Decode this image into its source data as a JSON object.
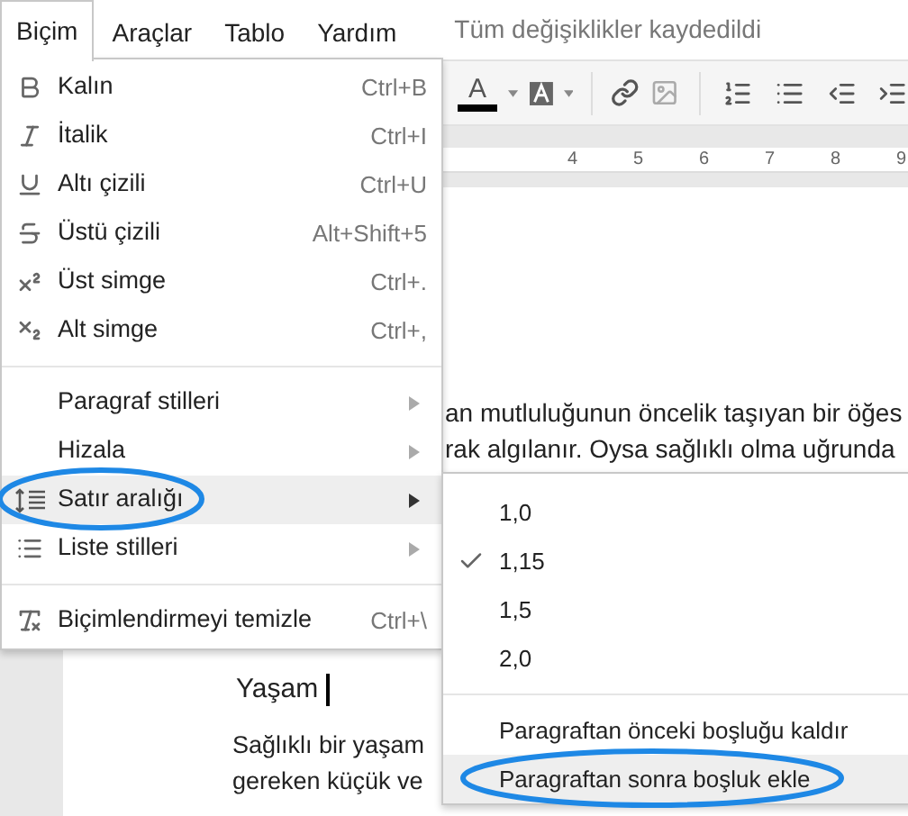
{
  "menubar": [
    {
      "label": "Biçim",
      "selected": true
    },
    {
      "label": "Araçlar",
      "selected": false
    },
    {
      "label": "Tablo",
      "selected": false
    },
    {
      "label": "Yardım",
      "selected": false
    }
  ],
  "save_status": "Tüm değişiklikler kaydedildi",
  "toolbar": {
    "text_color_label": "A"
  },
  "ruler": {
    "labels": [
      "4",
      "5",
      "6",
      "7",
      "8",
      "9"
    ]
  },
  "document": {
    "lines_top": [
      "an mutluluğunun öncelik taşıyan bir öğes",
      "rak algılanır. Oysa sağlıklı olma uğrunda"
    ],
    "heading": "Yaşam",
    "lines_bottom": [
      "Sağlıklı bir yaşam",
      "gereken küçük ve"
    ]
  },
  "format_menu": {
    "groups": [
      [
        {
          "label": "Kalın",
          "shortcut": "Ctrl+B",
          "submenu": false,
          "selected": false
        },
        {
          "label": "İtalik",
          "shortcut": "Ctrl+I",
          "submenu": false,
          "selected": false
        },
        {
          "label": "Altı çizili",
          "shortcut": "Ctrl+U",
          "submenu": false,
          "selected": false
        },
        {
          "label": "Üstü çizili",
          "shortcut": "Alt+Shift+5",
          "submenu": false,
          "selected": false
        },
        {
          "label": "Üst simge",
          "shortcut": "Ctrl+.",
          "submenu": false,
          "selected": false
        },
        {
          "label": "Alt simge",
          "shortcut": "Ctrl+,",
          "submenu": false,
          "selected": false
        }
      ],
      [
        {
          "label": "Paragraf stilleri",
          "submenu": true,
          "selected": false
        },
        {
          "label": "Hizala",
          "submenu": true,
          "selected": false
        },
        {
          "label": "Satır aralığı",
          "submenu": true,
          "selected": true
        },
        {
          "label": "Liste stilleri",
          "submenu": true,
          "selected": false
        }
      ],
      [
        {
          "label": "Biçimlendirmeyi temizle",
          "shortcut": "Ctrl+\\",
          "submenu": false,
          "selected": false
        }
      ]
    ]
  },
  "line_spacing_menu": {
    "groups": [
      [
        {
          "label": "1,0",
          "checked": false,
          "selected": false
        },
        {
          "label": "1,15",
          "checked": true,
          "selected": false
        },
        {
          "label": "1,5",
          "checked": false,
          "selected": false
        },
        {
          "label": "2,0",
          "checked": false,
          "selected": false
        }
      ],
      [
        {
          "label": "Paragraftan önceki boşluğu kaldır",
          "checked": false,
          "selected": false
        },
        {
          "label": "Paragraftan sonra boşluk ekle",
          "checked": false,
          "selected": true
        }
      ]
    ]
  }
}
